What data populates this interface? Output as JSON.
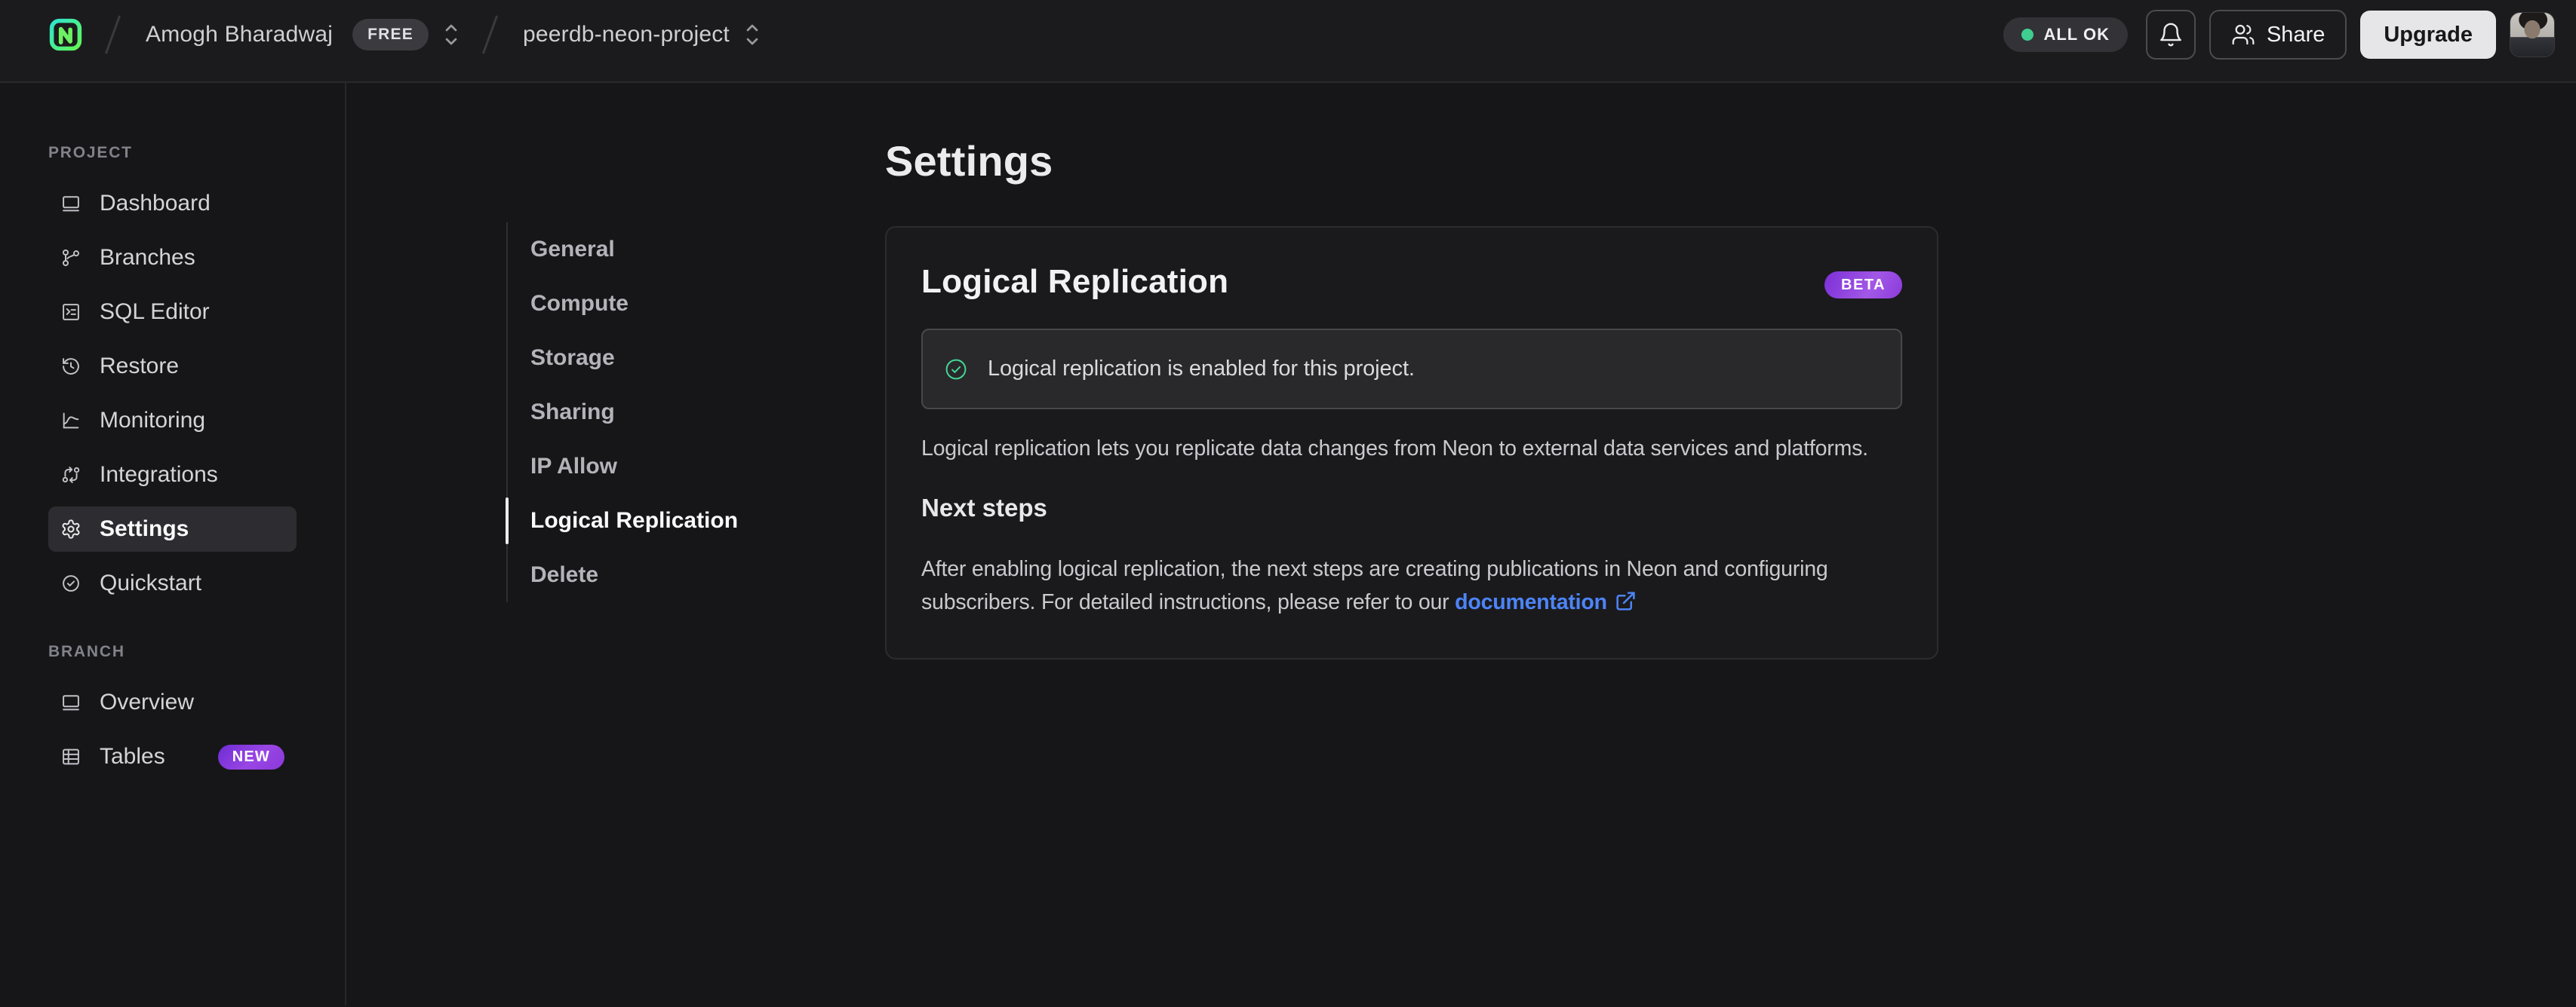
{
  "topbar": {
    "logo_icon": "neon-logo",
    "account": {
      "name": "Amogh Bharadwaj",
      "plan_badge": "FREE",
      "switcher_icon": "chevron-up-down-icon"
    },
    "project": {
      "name": "peerdb-neon-project",
      "switcher_icon": "chevron-up-down-icon"
    },
    "status": {
      "label": "ALL OK",
      "dot_color": "#3fce8e"
    },
    "notifications_icon": "bell-icon",
    "share": {
      "label": "Share",
      "icon": "users-icon"
    },
    "upgrade_label": "Upgrade",
    "avatar": "user-avatar"
  },
  "sidebar": {
    "project_section": {
      "label": "PROJECT",
      "items": [
        {
          "label": "Dashboard",
          "icon": "window-icon",
          "active": false
        },
        {
          "label": "Branches",
          "icon": "git-branch-icon",
          "active": false
        },
        {
          "label": "SQL Editor",
          "icon": "terminal-square-icon",
          "active": false
        },
        {
          "label": "Restore",
          "icon": "history-clock-icon",
          "active": false
        },
        {
          "label": "Monitoring",
          "icon": "chart-curve-icon",
          "active": false
        },
        {
          "label": "Integrations",
          "icon": "sync-arrows-icon",
          "active": false
        },
        {
          "label": "Settings",
          "icon": "gear-icon",
          "active": true
        },
        {
          "label": "Quickstart",
          "icon": "check-circle-icon",
          "active": false
        }
      ]
    },
    "branch_section": {
      "label": "BRANCH",
      "items": [
        {
          "label": "Overview",
          "icon": "window-icon",
          "active": false
        },
        {
          "label": "Tables",
          "icon": "table-icon",
          "badge": "NEW",
          "active": false
        }
      ]
    }
  },
  "settings": {
    "page_title": "Settings",
    "nav": {
      "items": [
        {
          "label": "General",
          "active": false
        },
        {
          "label": "Compute",
          "active": false
        },
        {
          "label": "Storage",
          "active": false
        },
        {
          "label": "Sharing",
          "active": false
        },
        {
          "label": "IP Allow",
          "active": false
        },
        {
          "label": "Logical Replication",
          "active": true
        },
        {
          "label": "Delete",
          "active": false
        }
      ]
    },
    "panel": {
      "title": "Logical Replication",
      "beta_badge": "BETA",
      "alert": {
        "icon": "check-circle-icon",
        "text": "Logical replication is enabled for this project."
      },
      "description": "Logical replication lets you replicate data changes from Neon to external data services and platforms.",
      "next_steps_title": "Next steps",
      "next_steps_text": "After enabling logical replication, the next steps are creating publications in Neon and configuring subscribers. For detailed instructions, please refer to our",
      "link": {
        "label": "documentation",
        "icon": "external-link-icon"
      }
    }
  },
  "colors": {
    "topbar_bg": "#1b1b1d",
    "page_bg": "#161618",
    "card_bg": "#1a1a1d",
    "accent_green": "#3fce8e",
    "badge_purple": "#8c3bdc",
    "link_blue": "#4d84f7"
  }
}
